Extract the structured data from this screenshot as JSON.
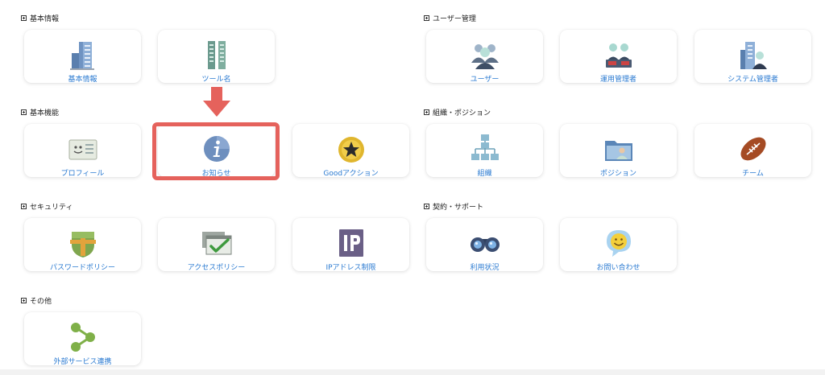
{
  "sections": {
    "basic_info": "基本情報",
    "user_management": "ユーザー管理",
    "basic_functions": "基本機能",
    "organization": "組織・ポジション",
    "security": "セキュリティ",
    "contract": "契約・サポート",
    "others": "その他"
  },
  "cards": {
    "basic_info": "基本情報",
    "tool_name": "ツール名",
    "user": "ユーザー",
    "operation_manager": "運用管理者",
    "system_manager": "システム管理者",
    "profile": "プロフィール",
    "notice": "お知らせ",
    "good_action": "Goodアクション",
    "organization": "組織",
    "position": "ポジション",
    "team": "チーム",
    "password_policy": "パスワードポリシー",
    "access_policy": "アクセスポリシー",
    "ip_restriction": "IPアドレス制限",
    "usage": "利用状況",
    "contact": "お問い合わせ",
    "external_service": "外部サービス連携"
  },
  "icons": {
    "basic_info": "building-icon",
    "tool_name": "twin-towers-icon",
    "user": "user-group-icon",
    "operation_manager": "operators-icon",
    "system_manager": "system-admin-icon",
    "profile": "id-card-icon",
    "notice": "info-icon",
    "good_action": "star-badge-icon",
    "organization": "org-chart-icon",
    "position": "folder-user-icon",
    "team": "rugby-ball-icon",
    "password_policy": "shield-icon",
    "access_policy": "checked-window-icon",
    "ip_restriction": "ip-icon",
    "usage": "binoculars-icon",
    "contact": "smiley-bubble-icon",
    "external_service": "share-icon"
  },
  "colors": {
    "link": "#2a7ad1",
    "highlight": "#e5625c"
  }
}
